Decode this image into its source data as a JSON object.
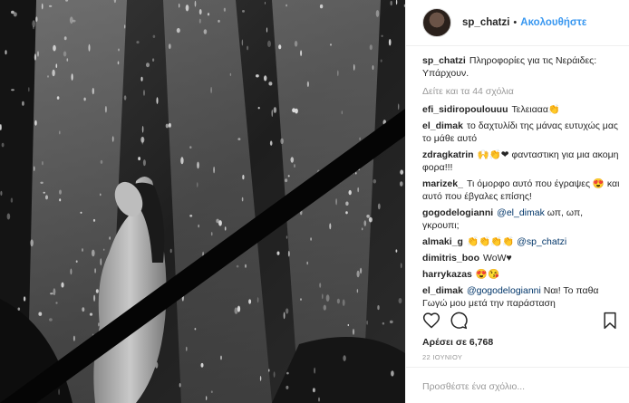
{
  "header": {
    "username": "sp_chatzi",
    "separator": "•",
    "follow_label": "Ακολουθήστε"
  },
  "caption": {
    "username": "sp_chatzi",
    "text": "Πληροφορίες για τις Νεράιδες: Υπάρχουν."
  },
  "view_all_comments": "Δείτε και τα 44 σχόλια",
  "comments": [
    {
      "username": "efi_sidiropoulouuu",
      "text": "Τελειααα👏"
    },
    {
      "username": "el_dimak",
      "text": "το δαχτυλίδι της μάνας ευτυχώς μας το μάθε αυτό"
    },
    {
      "username": "zdragkatrin",
      "text": "🙌👏❤ φανταστικη για μια ακομη φορα!!!"
    },
    {
      "username": "marizek_",
      "text": "Τι όμορφο αυτό που έγραψες 😍 και αυτό που έβγαλες επίσης!"
    },
    {
      "username": "gogodelogianni",
      "mention": "@el_dimak",
      "text": " ωπ, ωπ, γκρουπι;"
    },
    {
      "username": "almaki_g",
      "emoji": "👏👏👏👏",
      "mention": "@sp_chatzi"
    },
    {
      "username": "dimitris_boo",
      "text": "WoW♥"
    },
    {
      "username": "harrykazas",
      "text": "😍😘"
    },
    {
      "username": "el_dimak",
      "mention": "@gogodelogianni",
      "text": " Ναι! Το παθα Γωγώ μου μετά την παράσταση"
    }
  ],
  "actions": {
    "like_icon": "heart-icon",
    "comment_icon": "comment-icon",
    "save_icon": "bookmark-icon"
  },
  "likes": "Αρέσει σε 6,768",
  "date": "22 ΙΟΥΝΙΟΥ",
  "add_comment": {
    "placeholder": "Προσθέστε ένα σχόλιο..."
  },
  "colors": {
    "accent": "#3897f0",
    "mention": "#003569",
    "muted": "#999999",
    "text": "#262626"
  }
}
